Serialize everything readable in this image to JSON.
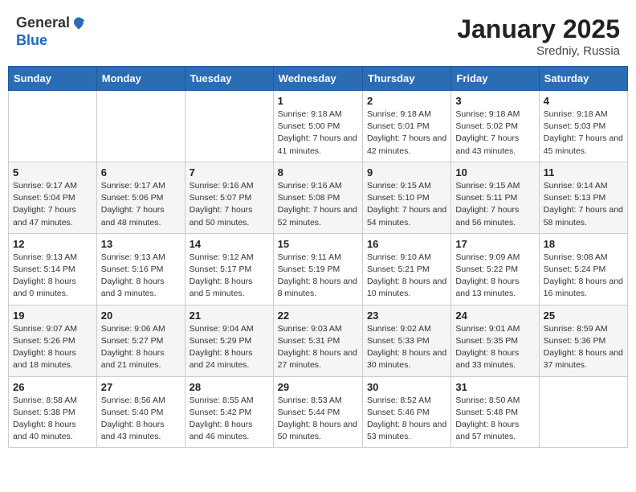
{
  "header": {
    "logo_line1": "General",
    "logo_line2": "Blue",
    "month": "January 2025",
    "location": "Sredniy, Russia"
  },
  "weekdays": [
    "Sunday",
    "Monday",
    "Tuesday",
    "Wednesday",
    "Thursday",
    "Friday",
    "Saturday"
  ],
  "weeks": [
    [
      {
        "day": "",
        "sunrise": "",
        "sunset": "",
        "daylight": ""
      },
      {
        "day": "",
        "sunrise": "",
        "sunset": "",
        "daylight": ""
      },
      {
        "day": "",
        "sunrise": "",
        "sunset": "",
        "daylight": ""
      },
      {
        "day": "1",
        "sunrise": "Sunrise: 9:18 AM",
        "sunset": "Sunset: 5:00 PM",
        "daylight": "Daylight: 7 hours and 41 minutes."
      },
      {
        "day": "2",
        "sunrise": "Sunrise: 9:18 AM",
        "sunset": "Sunset: 5:01 PM",
        "daylight": "Daylight: 7 hours and 42 minutes."
      },
      {
        "day": "3",
        "sunrise": "Sunrise: 9:18 AM",
        "sunset": "Sunset: 5:02 PM",
        "daylight": "Daylight: 7 hours and 43 minutes."
      },
      {
        "day": "4",
        "sunrise": "Sunrise: 9:18 AM",
        "sunset": "Sunset: 5:03 PM",
        "daylight": "Daylight: 7 hours and 45 minutes."
      }
    ],
    [
      {
        "day": "5",
        "sunrise": "Sunrise: 9:17 AM",
        "sunset": "Sunset: 5:04 PM",
        "daylight": "Daylight: 7 hours and 47 minutes."
      },
      {
        "day": "6",
        "sunrise": "Sunrise: 9:17 AM",
        "sunset": "Sunset: 5:06 PM",
        "daylight": "Daylight: 7 hours and 48 minutes."
      },
      {
        "day": "7",
        "sunrise": "Sunrise: 9:16 AM",
        "sunset": "Sunset: 5:07 PM",
        "daylight": "Daylight: 7 hours and 50 minutes."
      },
      {
        "day": "8",
        "sunrise": "Sunrise: 9:16 AM",
        "sunset": "Sunset: 5:08 PM",
        "daylight": "Daylight: 7 hours and 52 minutes."
      },
      {
        "day": "9",
        "sunrise": "Sunrise: 9:15 AM",
        "sunset": "Sunset: 5:10 PM",
        "daylight": "Daylight: 7 hours and 54 minutes."
      },
      {
        "day": "10",
        "sunrise": "Sunrise: 9:15 AM",
        "sunset": "Sunset: 5:11 PM",
        "daylight": "Daylight: 7 hours and 56 minutes."
      },
      {
        "day": "11",
        "sunrise": "Sunrise: 9:14 AM",
        "sunset": "Sunset: 5:13 PM",
        "daylight": "Daylight: 7 hours and 58 minutes."
      }
    ],
    [
      {
        "day": "12",
        "sunrise": "Sunrise: 9:13 AM",
        "sunset": "Sunset: 5:14 PM",
        "daylight": "Daylight: 8 hours and 0 minutes."
      },
      {
        "day": "13",
        "sunrise": "Sunrise: 9:13 AM",
        "sunset": "Sunset: 5:16 PM",
        "daylight": "Daylight: 8 hours and 3 minutes."
      },
      {
        "day": "14",
        "sunrise": "Sunrise: 9:12 AM",
        "sunset": "Sunset: 5:17 PM",
        "daylight": "Daylight: 8 hours and 5 minutes."
      },
      {
        "day": "15",
        "sunrise": "Sunrise: 9:11 AM",
        "sunset": "Sunset: 5:19 PM",
        "daylight": "Daylight: 8 hours and 8 minutes."
      },
      {
        "day": "16",
        "sunrise": "Sunrise: 9:10 AM",
        "sunset": "Sunset: 5:21 PM",
        "daylight": "Daylight: 8 hours and 10 minutes."
      },
      {
        "day": "17",
        "sunrise": "Sunrise: 9:09 AM",
        "sunset": "Sunset: 5:22 PM",
        "daylight": "Daylight: 8 hours and 13 minutes."
      },
      {
        "day": "18",
        "sunrise": "Sunrise: 9:08 AM",
        "sunset": "Sunset: 5:24 PM",
        "daylight": "Daylight: 8 hours and 16 minutes."
      }
    ],
    [
      {
        "day": "19",
        "sunrise": "Sunrise: 9:07 AM",
        "sunset": "Sunset: 5:26 PM",
        "daylight": "Daylight: 8 hours and 18 minutes."
      },
      {
        "day": "20",
        "sunrise": "Sunrise: 9:06 AM",
        "sunset": "Sunset: 5:27 PM",
        "daylight": "Daylight: 8 hours and 21 minutes."
      },
      {
        "day": "21",
        "sunrise": "Sunrise: 9:04 AM",
        "sunset": "Sunset: 5:29 PM",
        "daylight": "Daylight: 8 hours and 24 minutes."
      },
      {
        "day": "22",
        "sunrise": "Sunrise: 9:03 AM",
        "sunset": "Sunset: 5:31 PM",
        "daylight": "Daylight: 8 hours and 27 minutes."
      },
      {
        "day": "23",
        "sunrise": "Sunrise: 9:02 AM",
        "sunset": "Sunset: 5:33 PM",
        "daylight": "Daylight: 8 hours and 30 minutes."
      },
      {
        "day": "24",
        "sunrise": "Sunrise: 9:01 AM",
        "sunset": "Sunset: 5:35 PM",
        "daylight": "Daylight: 8 hours and 33 minutes."
      },
      {
        "day": "25",
        "sunrise": "Sunrise: 8:59 AM",
        "sunset": "Sunset: 5:36 PM",
        "daylight": "Daylight: 8 hours and 37 minutes."
      }
    ],
    [
      {
        "day": "26",
        "sunrise": "Sunrise: 8:58 AM",
        "sunset": "Sunset: 5:38 PM",
        "daylight": "Daylight: 8 hours and 40 minutes."
      },
      {
        "day": "27",
        "sunrise": "Sunrise: 8:56 AM",
        "sunset": "Sunset: 5:40 PM",
        "daylight": "Daylight: 8 hours and 43 minutes."
      },
      {
        "day": "28",
        "sunrise": "Sunrise: 8:55 AM",
        "sunset": "Sunset: 5:42 PM",
        "daylight": "Daylight: 8 hours and 46 minutes."
      },
      {
        "day": "29",
        "sunrise": "Sunrise: 8:53 AM",
        "sunset": "Sunset: 5:44 PM",
        "daylight": "Daylight: 8 hours and 50 minutes."
      },
      {
        "day": "30",
        "sunrise": "Sunrise: 8:52 AM",
        "sunset": "Sunset: 5:46 PM",
        "daylight": "Daylight: 8 hours and 53 minutes."
      },
      {
        "day": "31",
        "sunrise": "Sunrise: 8:50 AM",
        "sunset": "Sunset: 5:48 PM",
        "daylight": "Daylight: 8 hours and 57 minutes."
      },
      {
        "day": "",
        "sunrise": "",
        "sunset": "",
        "daylight": ""
      }
    ]
  ]
}
